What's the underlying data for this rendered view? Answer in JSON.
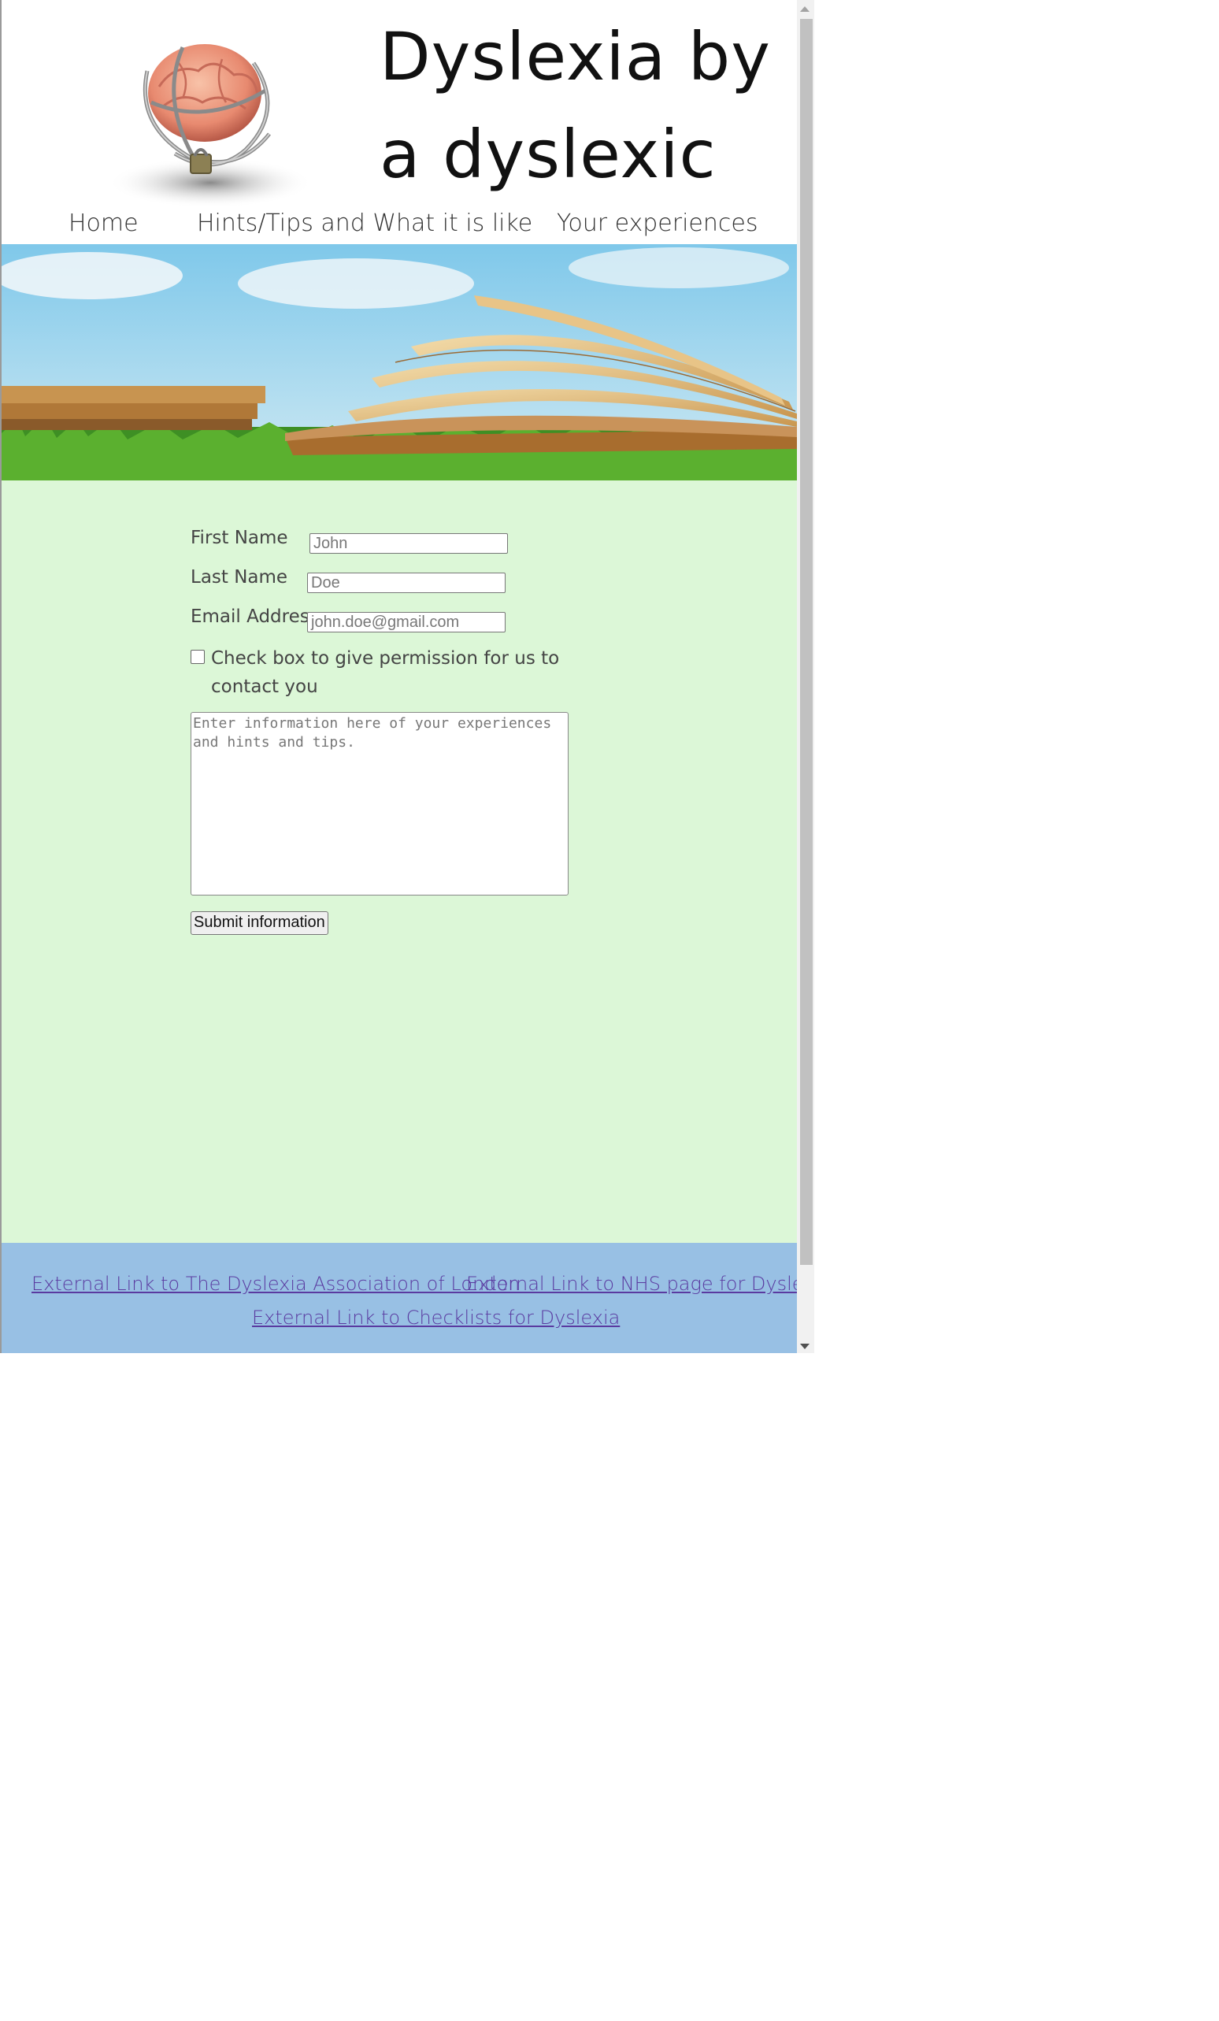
{
  "header": {
    "title": "Dyslexia by a dyslexic",
    "logo_icon": "chained-brain-icon"
  },
  "nav": {
    "items": [
      {
        "label": "Home"
      },
      {
        "label": "Hints/Tips and What it is like"
      },
      {
        "label": "Your experiences"
      }
    ]
  },
  "banner": {
    "icon": "open-book-on-grass-image"
  },
  "form": {
    "first_name_label": "First Name",
    "first_name_placeholder": "John",
    "last_name_label": "Last Name",
    "last_name_placeholder": "Doe",
    "email_label": "Email Address",
    "email_placeholder": "john.doe@gmail.com",
    "permission_label": "Check box to give permission for us to contact you",
    "experience_placeholder": "Enter information here of your experiences and hints and tips.",
    "submit_label": "Submit information"
  },
  "footer": {
    "links": [
      {
        "label": "External Link to The Dyslexia Association of London"
      },
      {
        "label": "External Link to NHS page for Dyslexia"
      },
      {
        "label": "External Link to Checklists for Dyslexia"
      }
    ]
  },
  "colors": {
    "content_bg": "#dcf7d7",
    "footer_bg": "#98c0e4",
    "link": "#5a3aa0"
  }
}
